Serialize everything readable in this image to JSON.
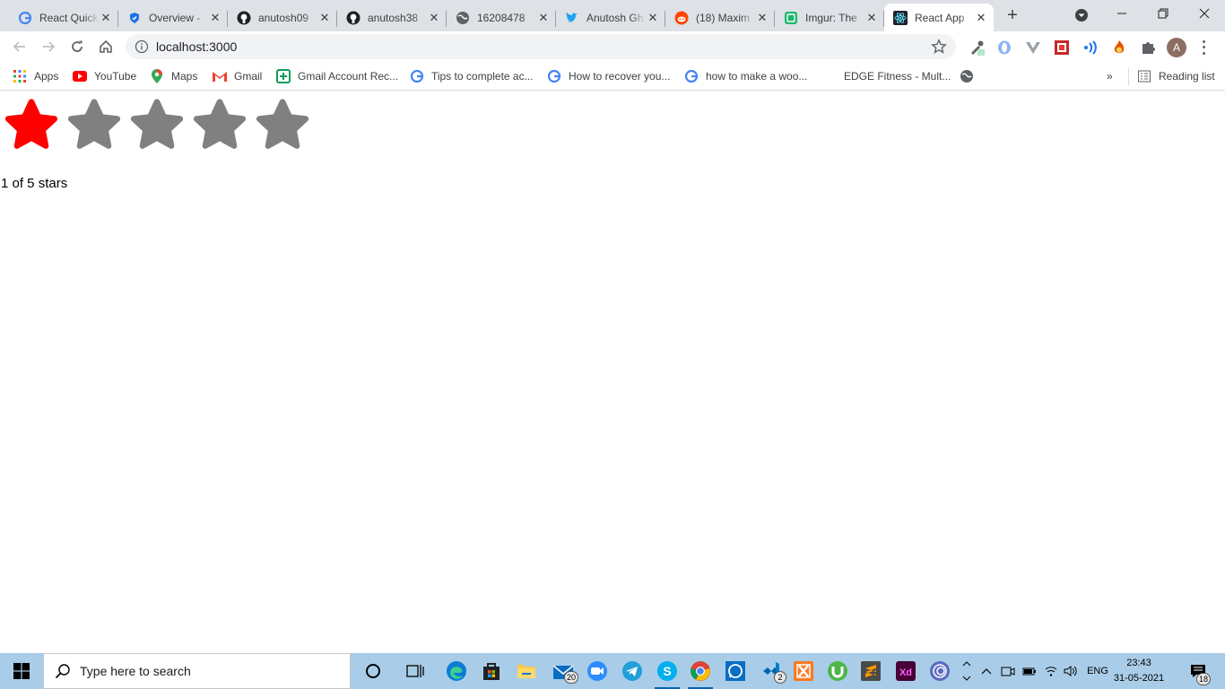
{
  "browser": {
    "tabs": [
      {
        "title": "React Quick Start",
        "icon": "google-g-icon"
      },
      {
        "title": "Overview - ",
        "icon": "shield-icon"
      },
      {
        "title": "anutosh09",
        "icon": "github-icon"
      },
      {
        "title": "anutosh38",
        "icon": "github-icon"
      },
      {
        "title": "16208478",
        "icon": "globe-icon"
      },
      {
        "title": "Anutosh Gh",
        "icon": "twitter-icon"
      },
      {
        "title": "(18) Maxim",
        "icon": "reddit-icon"
      },
      {
        "title": "Imgur: The",
        "icon": "imgur-icon"
      },
      {
        "title": "React App",
        "icon": "react-icon",
        "active": true
      }
    ],
    "url": "localhost:3000",
    "bookmarks": [
      {
        "label": "Apps",
        "icon": "apps-grid-icon"
      },
      {
        "label": "YouTube",
        "icon": "youtube-icon"
      },
      {
        "label": "Maps",
        "icon": "maps-pin-icon"
      },
      {
        "label": "Gmail",
        "icon": "gmail-icon"
      },
      {
        "label": "Gmail Account Rec...",
        "icon": "bookmark-plus-icon"
      },
      {
        "label": "Tips to complete ac...",
        "icon": "google-g-icon"
      },
      {
        "label": "How to recover you...",
        "icon": "google-g-icon"
      },
      {
        "label": "how to make a woo...",
        "icon": "google-g-icon"
      },
      {
        "label": "EDGE Fitness - Mult...",
        "icon": ""
      }
    ],
    "reading_list": "Reading list",
    "more_bookmarks": "»",
    "profile_initial": "A"
  },
  "rating": {
    "value": 1,
    "max": 5,
    "text": "1 of 5 stars",
    "filled_color": "#ff0000",
    "empty_color": "#808080"
  },
  "taskbar": {
    "search_placeholder": "Type here to search",
    "mail_badge": "20",
    "vscode_badge": "2",
    "language": "ENG",
    "time": "23:43",
    "date": "31-05-2021",
    "notifications": "18"
  }
}
